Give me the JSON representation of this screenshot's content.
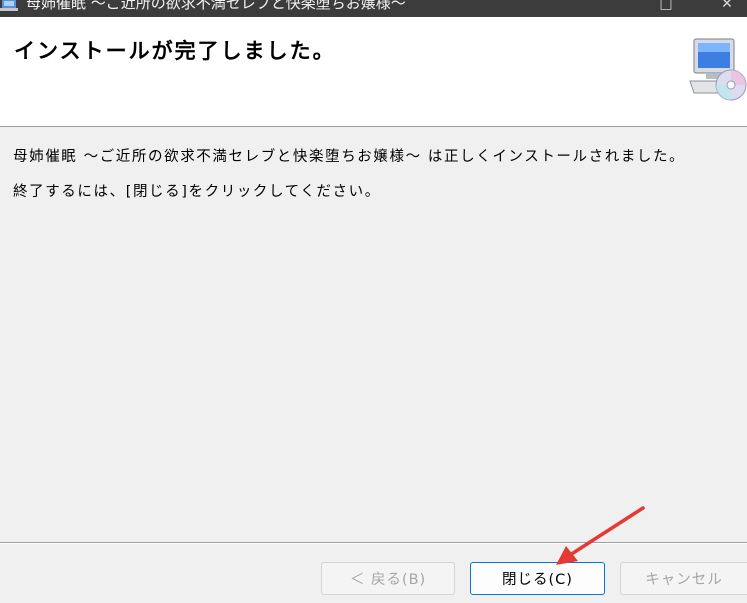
{
  "window": {
    "title": "母姉催眠 ～ご近所の欲求不満セレブと快楽堕ちお嬢様～",
    "minimize_glyph": "□",
    "close_glyph": "✕"
  },
  "header": {
    "title": "インストールが完了しました。"
  },
  "content": {
    "message": "母姉催眠 ～ご近所の欲求不満セレブと快楽堕ちお嬢様～ は正しくインストールされました。",
    "instruction": "終了するには、[閉じる]をクリックしてください。"
  },
  "buttons": {
    "back": "＜ 戻る(B)",
    "close": "閉じる(C)",
    "cancel": "キャンセル"
  },
  "colors": {
    "accent": "#0078d4",
    "annotation_arrow": "#e53935"
  }
}
